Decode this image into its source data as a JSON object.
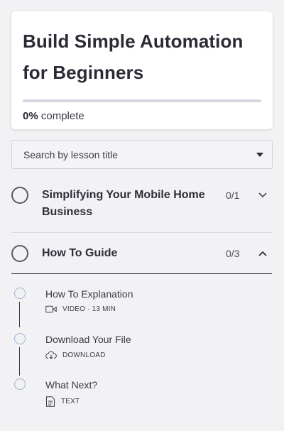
{
  "course": {
    "title_line1": "Build Simple Automation",
    "title_line2": "for Beginners",
    "progress_percent": 0,
    "progress_value": "0%",
    "progress_suffix": "complete"
  },
  "search": {
    "placeholder": "Search by lesson title"
  },
  "sections": [
    {
      "title": "Simplifying Your Mobile Home Business",
      "count": "0/1",
      "expanded": false
    },
    {
      "title": "How To Guide",
      "count": "0/3",
      "expanded": true
    }
  ],
  "lessons": [
    {
      "title": "How To Explanation",
      "meta": "VIDEO · 13 MIN",
      "icon": "video-icon"
    },
    {
      "title": "Download Your File",
      "meta": "DOWNLOAD",
      "icon": "download-icon"
    },
    {
      "title": "What Next?",
      "meta": "TEXT",
      "icon": "text-document-icon"
    }
  ],
  "colors": {
    "accent": "#3a3a6e",
    "progress_track": "#d7d5e2",
    "background": "#f2f2f4",
    "lesson_dot_border": "#9fb3d4"
  }
}
